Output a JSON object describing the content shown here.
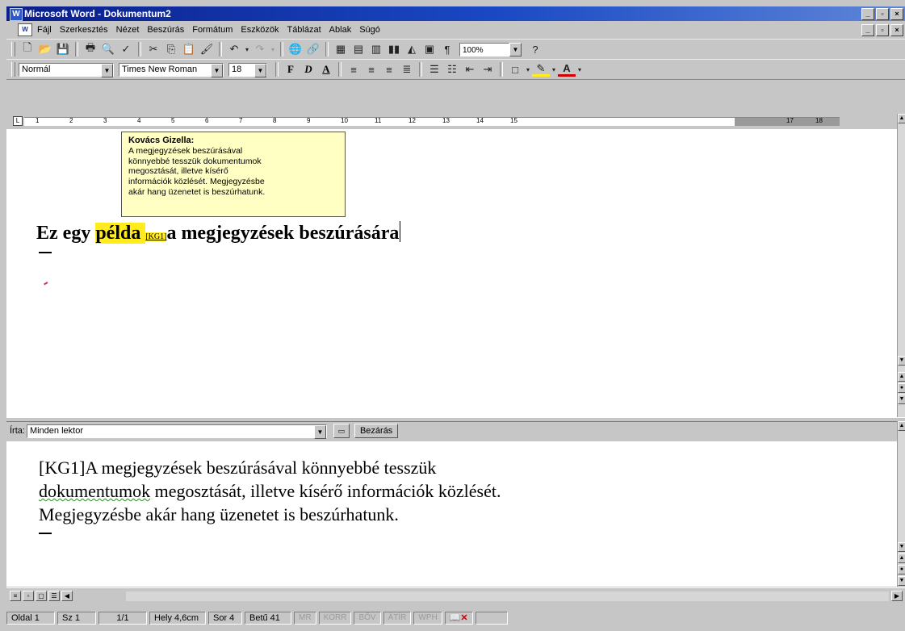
{
  "window": {
    "title": "Microsoft Word - Dokumentum2",
    "minimize": "_",
    "restore": "▫",
    "close": "×"
  },
  "menu": {
    "items": [
      "Fájl",
      "Szerkesztés",
      "Nézet",
      "Beszúrás",
      "Formátum",
      "Eszközök",
      "Táblázat",
      "Ablak",
      "Súgó"
    ]
  },
  "standard_toolbar": {
    "zoom": "100%"
  },
  "formatting_toolbar": {
    "style": "Normál",
    "font": "Times New Roman",
    "size": "18",
    "bold": "F",
    "italic": "D",
    "underline": "A"
  },
  "ruler": {
    "numbers": [
      "1",
      "2",
      "3",
      "4",
      "5",
      "6",
      "7",
      "8",
      "9",
      "10",
      "11",
      "12",
      "13",
      "14",
      "15",
      "17",
      "18"
    ]
  },
  "tooltip": {
    "author": "Kovács Gizella:",
    "lines": [
      "A megjegyzések beszúrásával",
      "könnyebbé tesszük dokumentumok",
      "megosztását, illetve kísérő",
      "információk  közlését. Megjegyzésbe",
      "akár hang üzenetet is beszúrhatunk."
    ]
  },
  "document": {
    "text_before": "Ez egy ",
    "highlighted": "példa ",
    "comment_ref": "[KG1]",
    "text_after": "a megjegyzések beszúrására"
  },
  "comment_pane": {
    "author_label": "Írta:",
    "reviewer": "Minden lektor",
    "close_button": "Bezárás",
    "ref": "[KG1]",
    "line1_rest": "A megjegyzések beszúrásával könnyebbé tesszük",
    "line2_squiggle": "dokumentumok",
    "line2_rest": " megosztását, illetve kísérő információk  közlését.",
    "line3": "Megjegyzésbe akár hang üzenetet is beszúrhatunk."
  },
  "status": {
    "page": "Oldal 1",
    "section": "Sz 1",
    "pages": "1/1",
    "position": "Hely 4,6cm",
    "line": "Sor 4",
    "column": "Betű 41",
    "mr": "MR",
    "korr": "KORR",
    "bov": "BŐV",
    "atir": "ÁTÍR",
    "wph": "WPH"
  },
  "colors": {
    "titlebar": "#0a1e8c",
    "highlight": "#ffeb1e",
    "tooltip_bg": "#ffffc4"
  }
}
